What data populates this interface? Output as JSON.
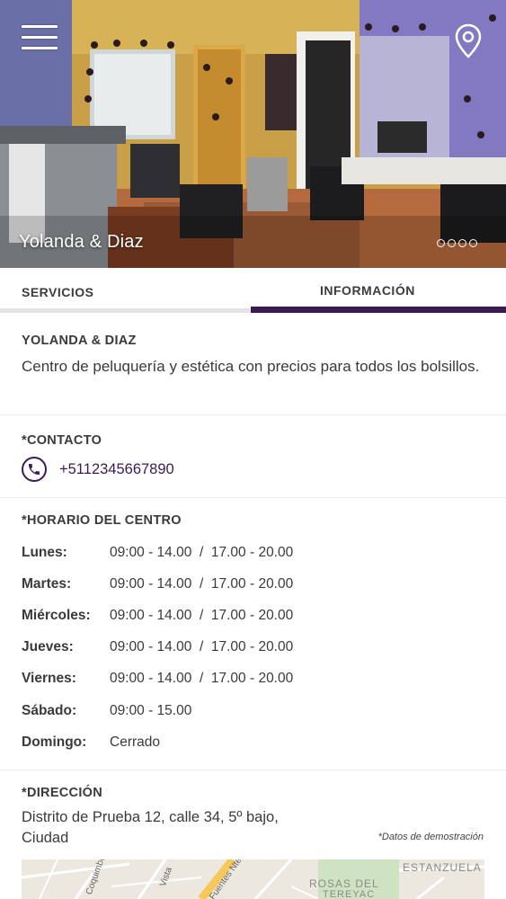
{
  "hero": {
    "title": "Yolanda & Diaz",
    "slides_count": 4,
    "active_slide": 0,
    "menu_icon": "hamburger-menu-icon",
    "location_icon": "map-pin-icon"
  },
  "tabs": [
    {
      "label": "SERVICIOS",
      "active": false
    },
    {
      "label": "INFORMACIÓN",
      "active": true
    }
  ],
  "info": {
    "name": "YOLANDA & DIAZ",
    "description": "Centro de peluquería y estética con precios para todos los bolsillos."
  },
  "contact": {
    "title": "*CONTACTO",
    "phone_icon": "phone-icon",
    "phone": "+5112345667890"
  },
  "schedule": {
    "title": "*HORARIO DEL CENTRO",
    "rows": [
      {
        "day": "Lunes:",
        "hours": "09:00 - 14.00  /  17.00 - 20.00"
      },
      {
        "day": "Martes:",
        "hours": "09:00 - 14.00  /  17.00 - 20.00"
      },
      {
        "day": "Miércoles:",
        "hours": "09:00 - 14.00  /  17.00 - 20.00"
      },
      {
        "day": "Jueves:",
        "hours": "09:00 - 14.00  /  17.00 - 20.00"
      },
      {
        "day": "Viernes:",
        "hours": "09:00 - 14.00  /  17.00 - 20.00"
      },
      {
        "day": "Sábado:",
        "hours": "09:00 - 15.00"
      },
      {
        "day": "Domingo:",
        "hours": "Cerrado"
      }
    ]
  },
  "address": {
    "title": "*DIRECCIÓN",
    "text": "Distrito de Prueba 12, calle 34, 5º bajo, Ciudad",
    "note": "*Datos de demostración"
  },
  "map": {
    "labels": [
      "ESTANZUELA",
      "ROSAS DEL",
      "TEREYAC",
      "Coquimbo",
      "Vista",
      "Fuentes Nte"
    ]
  },
  "colors": {
    "accent": "#3c1b54",
    "text": "#3a3a3a"
  }
}
